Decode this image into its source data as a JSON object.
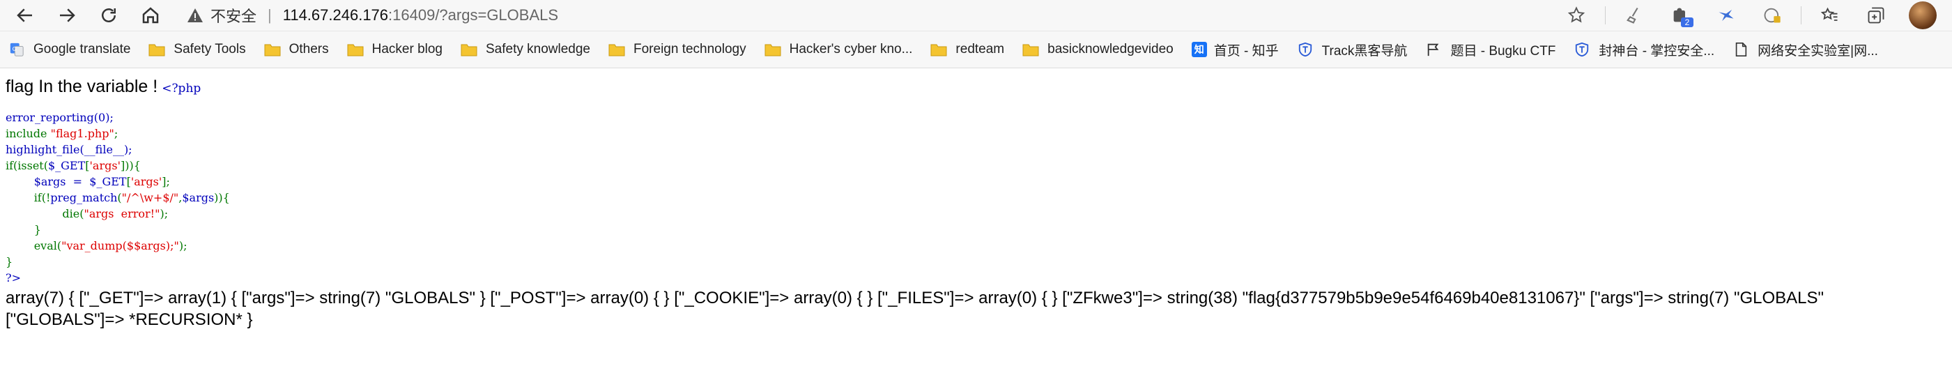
{
  "browser": {
    "insecure_label": "不安全",
    "separator": "|",
    "url_host": "114.67.246.176",
    "url_rest": ":16409/?args=GLOBALS",
    "extension_badge": "2",
    "bookmarks": [
      {
        "label": "Google translate",
        "icon": "google-translate-icon"
      },
      {
        "label": "Safety Tools",
        "icon": "folder-icon"
      },
      {
        "label": "Others",
        "icon": "folder-icon"
      },
      {
        "label": "Hacker blog",
        "icon": "folder-icon"
      },
      {
        "label": "Safety knowledge",
        "icon": "folder-icon"
      },
      {
        "label": "Foreign technology",
        "icon": "folder-icon"
      },
      {
        "label": "Hacker's cyber kno...",
        "icon": "folder-icon"
      },
      {
        "label": "redteam",
        "icon": "folder-icon"
      },
      {
        "label": "basicknowledgevideo",
        "icon": "folder-icon"
      },
      {
        "label": "首页 - 知乎",
        "icon": "zhihu-icon",
        "badge": "知"
      },
      {
        "label": "Track黑客导航",
        "icon": "shield-icon"
      },
      {
        "label": "题目 - Bugku CTF",
        "icon": "flag-icon"
      },
      {
        "label": "封神台 - 掌控安全...",
        "icon": "shield-icon"
      },
      {
        "label": "网络安全实验室|网...",
        "icon": "document-icon"
      }
    ]
  },
  "page": {
    "headline": "flag In the variable !",
    "php_open": "<?php",
    "code": {
      "l1": "error_reporting(0);",
      "l2_kw": "include ",
      "l2_str": "\"flag1.php\"",
      "l2_end": ";",
      "l3": "highlight_file(__file__);",
      "l4_a": "if(isset(",
      "l4_b": "$_GET",
      "l4_c": "[",
      "l4_d": "'args'",
      "l4_e": "])){",
      "l5_a": "        $args  =  $_GET",
      "l5_b": "[",
      "l5_c": "'args'",
      "l5_d": "];",
      "l6_a": "        if(!",
      "l6_b": "preg_match",
      "l6_c": "(",
      "l6_d": "\"/^\\w+$/\"",
      "l6_e": ",",
      "l6_f": "$args",
      "l6_g": ")){",
      "l7_a": "                die(",
      "l7_b": "\"args  error!\"",
      "l7_c": ");",
      "l8": "        }",
      "l9_a": "        eval(",
      "l9_b": "\"var_dump($$args);\"",
      "l9_c": ");",
      "l10": "}",
      "l11": "?>"
    },
    "output_line1": "array(7) { [\"_GET\"]=> array(1) { [\"args\"]=> string(7) \"GLOBALS\" } [\"_POST\"]=> array(0) { } [\"_COOKIE\"]=> array(0) { } [\"_FILES\"]=> array(0) { } [\"ZFkwe3\"]=> string(38) \"flag{d377579b5b9e9e54f6469b40e8131067}\" [\"args\"]=> string(7) \"GLOBALS\"",
    "output_line2": "[\"GLOBALS\"]=> *RECURSION* }"
  }
}
